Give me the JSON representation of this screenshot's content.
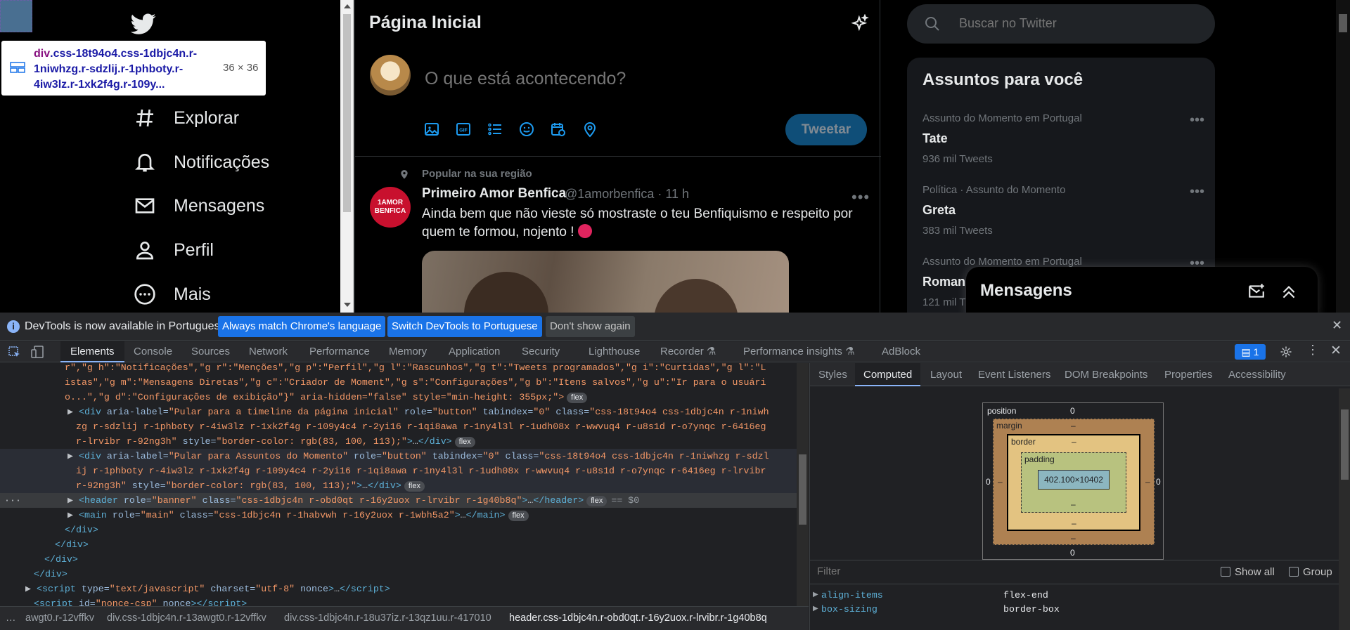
{
  "inspect_tooltip": {
    "selector_tag": "div",
    "selector_classes": ".css-18t94o4.css-1dbjc4n.r-1niwhzg.r-sdzlij.r-1phboty.r-4iw3lz.r-1xk2f4g.r-109y...",
    "size": "36 × 36"
  },
  "twitter": {
    "nav_partial": "al",
    "nav": [
      {
        "label": "Explorar",
        "icon": "hashtag-icon"
      },
      {
        "label": "Notificações",
        "icon": "bell-icon"
      },
      {
        "label": "Mensagens",
        "icon": "envelope-icon"
      },
      {
        "label": "Perfil",
        "icon": "person-icon"
      },
      {
        "label": "Mais",
        "icon": "more-circle-icon"
      }
    ],
    "home_title": "Página Inicial",
    "compose_placeholder": "O que está acontecendo?",
    "tweet_button": "Tweetar",
    "tweet": {
      "social_context": "Popular na sua região",
      "author_name": "Primeiro Amor Benfica",
      "author_handle": "@1amorbenfica · 11 h",
      "avatar_text": "1AMOR BENFICA",
      "text": "Ainda bem que não vieste só mostraste o teu Benfiquismo e respeito por quem te formou, nojento !"
    },
    "search_placeholder": "Buscar no Twitter",
    "trends_title": "Assuntos para você",
    "trends": [
      {
        "context": "Assunto do Momento em Portugal",
        "name": "Tate",
        "count": "936 mil Tweets"
      },
      {
        "context": "Política · Assunto do Momento",
        "name": "Greta",
        "count": "383 mil Tweets"
      },
      {
        "context": "Assunto do Momento em Portugal",
        "name": "Roman",
        "count": "121 mil T"
      }
    ],
    "messages_title": "Mensagens"
  },
  "devtools": {
    "infobar": {
      "text": "DevTools is now available in Portuguese!",
      "btn_match": "Always match Chrome's language",
      "btn_switch": "Switch DevTools to Portuguese",
      "btn_dont": "Don't show again"
    },
    "tabs": [
      "Elements",
      "Console",
      "Sources",
      "Network",
      "Performance",
      "Memory",
      "Application",
      "Security",
      "Lighthouse",
      "Recorder ⚗",
      "Performance insights ⚗",
      "AdBlock"
    ],
    "issues_count": "1",
    "side_tabs": [
      "Styles",
      "Computed",
      "Layout",
      "Event Listeners",
      "DOM Breakpoints",
      "Properties",
      "Accessibility"
    ],
    "code": {
      "l1": "r\",\"g h\":\"Notificações\",\"g r\":\"Menções\",\"g p\":\"Perfil\",\"g l\":\"Rascunhos\",\"g t\":\"Tweets programados\",\"g i\":\"Curtidas\",\"g l\":\"L",
      "l2": "istas\",\"g m\":\"Mensagens Diretas\",\"g c\":\"Criador de Moment\",\"g s\":\"Configurações\",\"g b\":\"Itens salvos\",\"g u\":\"Ir para o usuári",
      "l3": "o...\",\"g d\":\"Configurações de exibição\"}\" aria-hidden=\"false\" style=\"min-height: 355px;\">",
      "div1_label": "Pular para a timeline da página inicial",
      "div1_classes_1": "css-18t94o4 css-1dbjc4n r-1niwh",
      "div1_classes_2": "zg r-sdzlij r-1phboty r-4iw3lz r-1xk2f4g r-109y4c4 r-2yi16 r-1qi8awa r-1ny4l3l r-1udh08x r-wwvuq4 r-u8s1d r-o7ynqc r-6416eg",
      "div1_classes_3": "r-lrvibr r-92ng3h",
      "div2_label": "Pular para Assuntos do Momento",
      "div2_classes_1": "css-18t94o4 css-1dbjc4n r-1niwhzg r-sdzl",
      "div2_classes_2": "ij r-1phboty r-4iw3lz r-1xk2f4g r-109y4c4 r-2yi16 r-1qi8awa r-1ny4l3l r-1udh08x r-wwvuq4 r-u8s1d r-o7ynqc r-6416eg r-lrvibr",
      "div2_classes_3": "r-92ng3h",
      "style_val": "border-color: rgb(83, 100, 113);",
      "header_classes": "css-1dbjc4n r-obd0qt r-16y2uox r-lrvibr r-1g40b8q",
      "main_classes": "css-1dbjc4n r-1habvwh r-16y2uox r-1wbh5a2",
      "eq": "== $0",
      "pill": "flex"
    },
    "breadcrumbs": [
      "awgt0.r-12vffkv",
      "div.css-1dbjc4n.r-13awgt0.r-12vffkv",
      "div.css-1dbjc4n.r-18u37iz.r-13qz1uu.r-417010",
      "header.css-1dbjc4n.r-obd0qt.r-16y2uox.r-lrvibr.r-1g40b8q"
    ],
    "boxmodel": {
      "position_label": "position",
      "position_val": "0",
      "margin_label": "margin",
      "border_label": "border",
      "padding_label": "padding",
      "content": "402.100×10402",
      "dash": "–",
      "zero": "0"
    },
    "filter_placeholder": "Filter",
    "show_all": "Show all",
    "group": "Group",
    "props": [
      {
        "name": "align-items",
        "value": "flex-end"
      },
      {
        "name": "box-sizing",
        "value": "border-box"
      }
    ]
  }
}
